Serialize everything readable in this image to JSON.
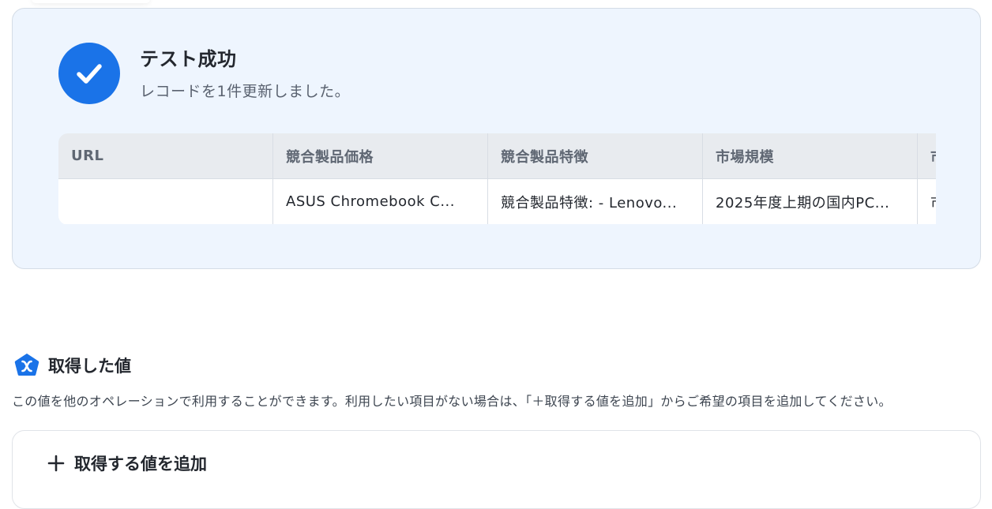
{
  "result": {
    "title": "テスト成功",
    "subtitle": "レコードを1件更新しました。",
    "status_color": "#1a73e8",
    "icon": "check-icon"
  },
  "table": {
    "columns": [
      "URL",
      "競合製品価格",
      "競合製品特徴",
      "市場規模",
      "市"
    ],
    "rows": [
      [
        "",
        "ASUS Chromebook C...",
        "競合製品特徴: - Lenovo...",
        "2025年度上期の国内PC...",
        "市"
      ]
    ]
  },
  "retrieved_values": {
    "icon": "yoom-pentagon-icon",
    "icon_color": "#1a73e8",
    "title": "取得した値",
    "description": "この値を他のオペレーションで利用することができます。利用したい項目がない場合は、「＋取得する値を追加」からご希望の項目を追加してください。",
    "add_icon": "plus-icon",
    "add_label": "取得する値を追加"
  }
}
